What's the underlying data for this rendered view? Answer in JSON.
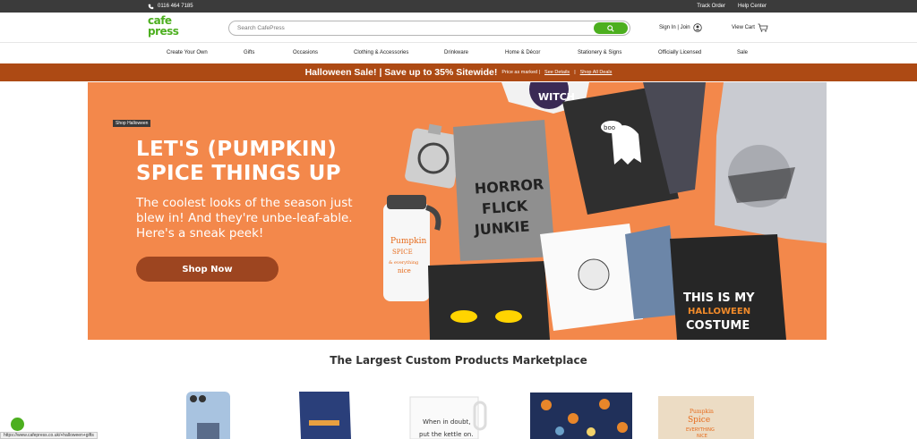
{
  "topbar": {
    "phone": "0116 464 7185",
    "links": [
      "Track Order",
      "Help Center"
    ]
  },
  "header": {
    "logo_line1": "cafe",
    "logo_line2": "press",
    "search_placeholder": "Search CafePress",
    "signin": "Sign In | Join",
    "cart": "View Cart"
  },
  "nav": [
    "Create Your Own",
    "Gifts",
    "Occasions",
    "Clothing & Accessories",
    "Drinkware",
    "Home & Décor",
    "Stationery & Signs",
    "Officially Licensed",
    "Sale"
  ],
  "promo": {
    "headline": "Halloween Sale! | Save up to 35% Sitewide!",
    "note": "Price as marked |",
    "details": "See Details",
    "sep": "|",
    "deals": "Shop All Deals"
  },
  "hero": {
    "tag": "Shop Halloween",
    "title_line1": "LET'S (PUMPKIN)",
    "title_line2": "SPICE THINGS UP",
    "subtitle": "The coolest looks of the season just blew in! And they're unbe-leaf-able. Here's a sneak peek!",
    "button": "Shop Now",
    "shirt_texts": [
      "HORROR",
      "FLICK",
      "JUNKIE",
      "THIS IS MY",
      "HALLOWEEN",
      "COSTUME",
      "boo",
      "WITCH",
      "Pumpkin",
      "SPICE",
      "& everything",
      "nice"
    ]
  },
  "section_title": "The Largest Custom Products Marketplace",
  "products": {
    "mug_text_1": "When in doubt,",
    "mug_text_2": "put the kettle on.",
    "tote_text_1": "Pumpkin",
    "tote_text_2": "Spice",
    "tote_text_3": "EVERYTHING",
    "tote_text_4": "NICE"
  },
  "statusbar": "https://www.cafepress.co.uk/+halloween+gifts",
  "colors": {
    "brand_green": "#4caf1f",
    "promo_bg": "#ad4a14",
    "hero_bg": "#f3884b",
    "hero_button": "#9d4520"
  }
}
